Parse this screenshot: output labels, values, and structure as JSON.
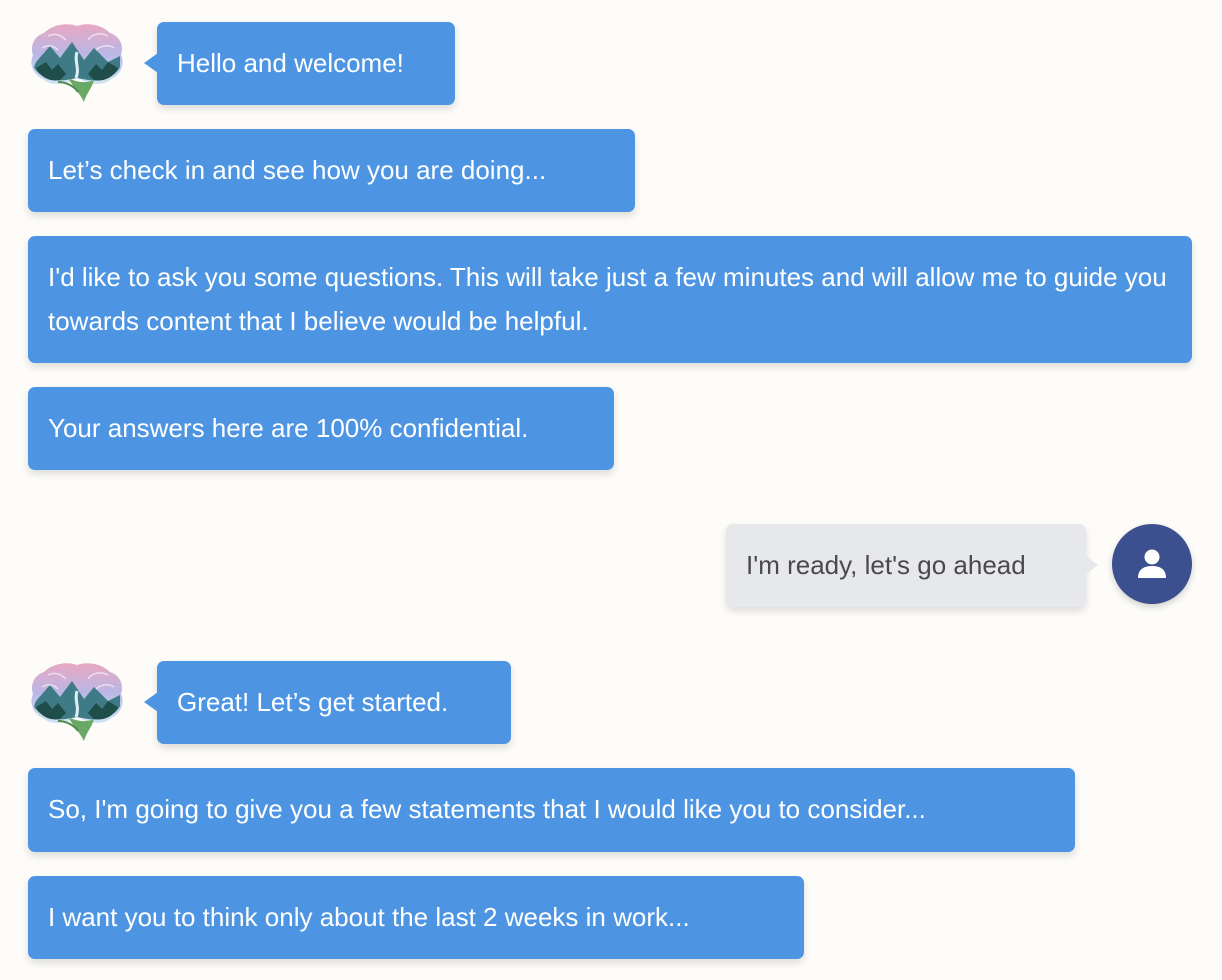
{
  "messages": [
    {
      "sender": "bot",
      "text": "Hello and welcome!"
    },
    {
      "sender": "bot",
      "text": "Let’s check in and see how you are doing..."
    },
    {
      "sender": "bot",
      "text": "I'd like to ask you some questions. This will take just a few minutes and will allow me to guide you towards content that I believe would be helpful."
    },
    {
      "sender": "bot",
      "text": "Your answers here are 100% confidential."
    },
    {
      "sender": "user",
      "text": "I'm ready, let's go ahead"
    },
    {
      "sender": "bot",
      "text": "Great! Let’s get started."
    },
    {
      "sender": "bot",
      "text": "So, I'm going to give you a few statements that I would like you to consider..."
    },
    {
      "sender": "bot",
      "text": "I want you to think only about the last 2 weeks in work..."
    }
  ],
  "icons": {
    "bot_avatar": "brain-landscape-icon",
    "user_avatar": "person-icon"
  },
  "colors": {
    "background": "#fdfcf9",
    "bot_bubble": "#4d95e3",
    "bot_text": "#ffffff",
    "user_bubble": "#e7e8ec",
    "user_text": "#4a4a4a",
    "user_avatar": "#3c4f8e"
  }
}
